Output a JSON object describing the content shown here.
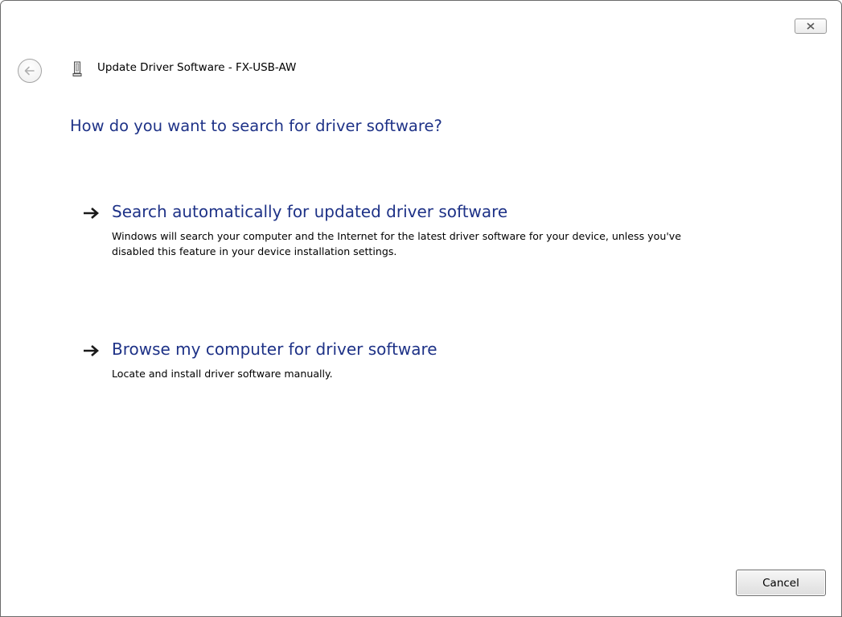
{
  "window": {
    "title": "Update Driver Software - FX-USB-AW"
  },
  "main": {
    "heading": "How do you want to search for driver software?"
  },
  "options": [
    {
      "title": "Search automatically for updated driver software",
      "description": "Windows will search your computer and the Internet for the latest driver software for your device, unless you've disabled this feature in your device installation settings."
    },
    {
      "title": "Browse my computer for driver software",
      "description": "Locate and install driver software manually."
    }
  ],
  "footer": {
    "cancel_label": "Cancel"
  },
  "icons": {
    "close": "close-icon",
    "back": "back-arrow-icon",
    "device": "usb-device-icon",
    "option_arrow": "arrow-right-icon"
  },
  "colors": {
    "heading": "#1e3287",
    "border": "#6b6b6b",
    "background": "#ffffff"
  }
}
